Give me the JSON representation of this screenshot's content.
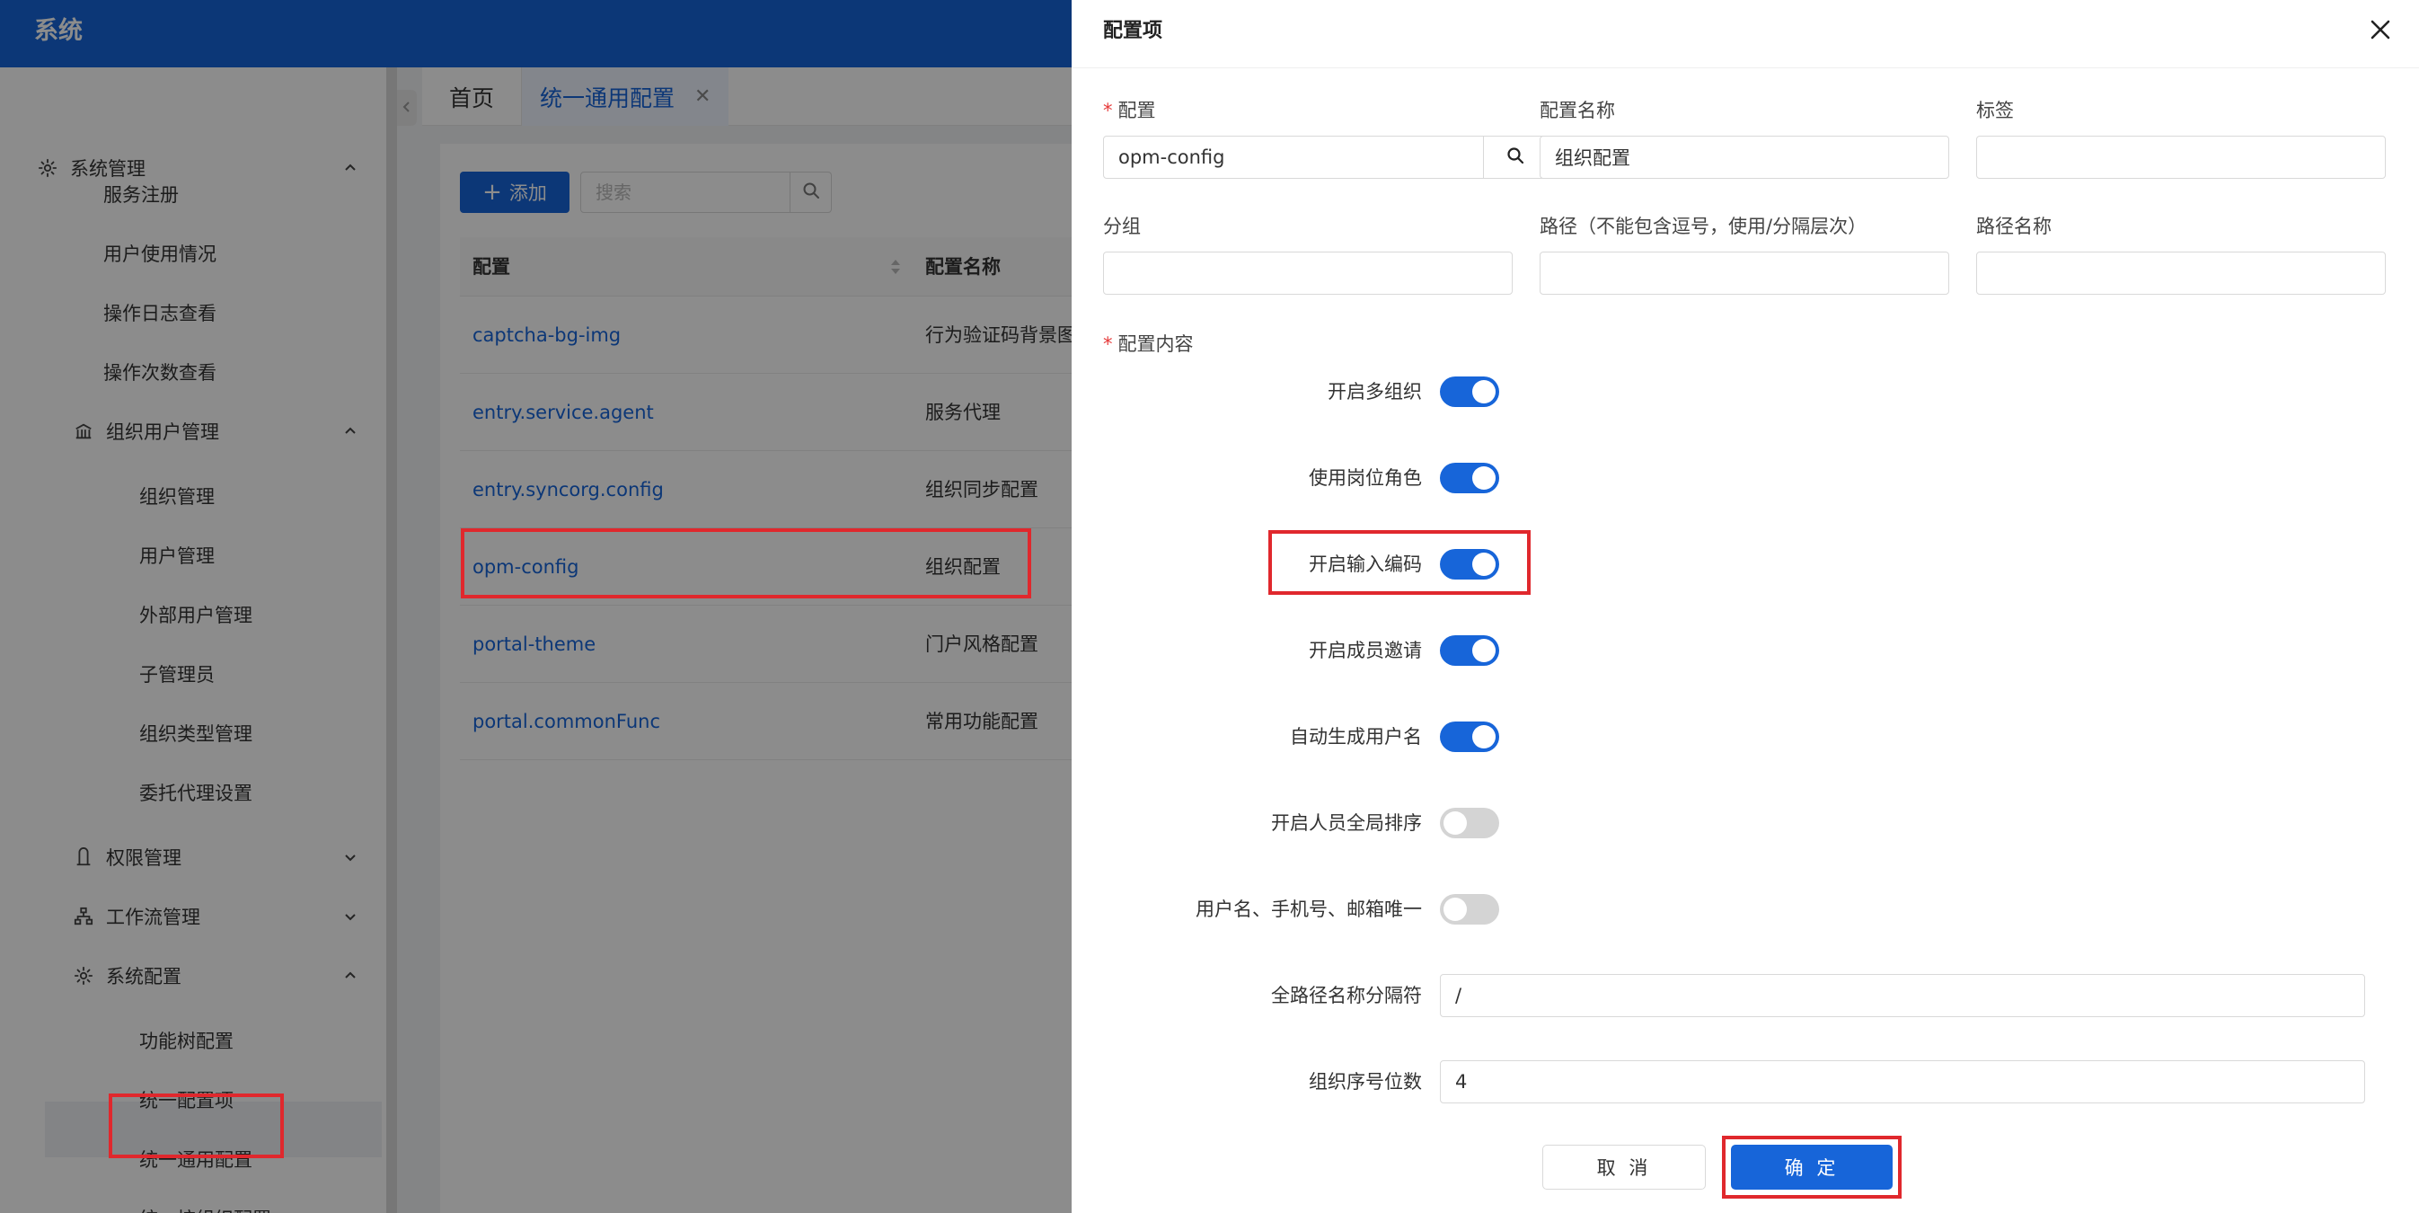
{
  "app": {
    "title": "系统"
  },
  "sidebar": {
    "groups": [
      {
        "label": "系统管理",
        "icon": "gear-icon",
        "expanded": true
      },
      {
        "label": "组织用户管理",
        "icon": "building-icon",
        "expanded": true
      },
      {
        "label": "权限管理",
        "icon": "user-role-icon",
        "expanded": false
      },
      {
        "label": "工作流管理",
        "icon": "flow-icon",
        "expanded": false
      },
      {
        "label": "系统配置",
        "icon": "gear-icon",
        "expanded": true
      }
    ],
    "items": {
      "service_register": "服务注册",
      "user_usage": "用户使用情况",
      "op_log": "操作日志查看",
      "op_count": "操作次数查看",
      "org_manage": "组织管理",
      "user_manage": "用户管理",
      "external_user": "外部用户管理",
      "sub_admin": "子管理员",
      "org_type": "组织类型管理",
      "delegate": "委托代理设置",
      "func_tree": "功能树配置",
      "unified_item": "统一配置项",
      "unified_common": "统一通用配置",
      "unified_by_org": "统一按组织配置"
    },
    "active_item": "统一通用配置"
  },
  "tabs": {
    "home": "首页",
    "active": "统一通用配置",
    "close_glyph": "✕"
  },
  "toolbar": {
    "add_label": "添加",
    "search_placeholder": "搜索"
  },
  "table": {
    "columns": [
      "配置",
      "配置名称"
    ],
    "rows": [
      {
        "key": "captcha-bg-img",
        "name": "行为验证码背景图"
      },
      {
        "key": "entry.service.agent",
        "name": "服务代理"
      },
      {
        "key": "entry.syncorg.config",
        "name": "组织同步配置"
      },
      {
        "key": "opm-config",
        "name": "组织配置"
      },
      {
        "key": "portal-theme",
        "name": "门户风格配置"
      },
      {
        "key": "portal.commonFunc",
        "name": "常用功能配置"
      }
    ]
  },
  "drawer": {
    "title": "配置项",
    "fields": {
      "config": {
        "label": "配置",
        "value": "opm-config",
        "required_mark": "*"
      },
      "config_name": {
        "label": "配置名称",
        "value": "组织配置"
      },
      "tag": {
        "label": "标签",
        "value": ""
      },
      "group": {
        "label": "分组",
        "value": ""
      },
      "path": {
        "label": "路径（不能包含逗号，使用/分隔层次）",
        "value": ""
      },
      "path_name": {
        "label": "路径名称",
        "value": ""
      }
    },
    "content_label": "配置内容",
    "content_required_mark": "*",
    "switches": [
      {
        "label": "开启多组织",
        "on": true
      },
      {
        "label": "使用岗位角色",
        "on": true
      },
      {
        "label": "开启输入编码",
        "on": true
      },
      {
        "label": "开启成员邀请",
        "on": true
      },
      {
        "label": "自动生成用户名",
        "on": true
      },
      {
        "label": "开启人员全局排序",
        "on": false
      },
      {
        "label": "用户名、手机号、邮箱唯一",
        "on": false
      }
    ],
    "separator": {
      "label": "全路径名称分隔符",
      "value": "/"
    },
    "seq_digits": {
      "label": "组织序号位数",
      "value": "4"
    },
    "cancel_label": "取 消",
    "ok_label": "确 定"
  },
  "colors": {
    "primary": "#1765d9",
    "highlight": "#e0282d",
    "switch_off": "#d4d4d4"
  }
}
